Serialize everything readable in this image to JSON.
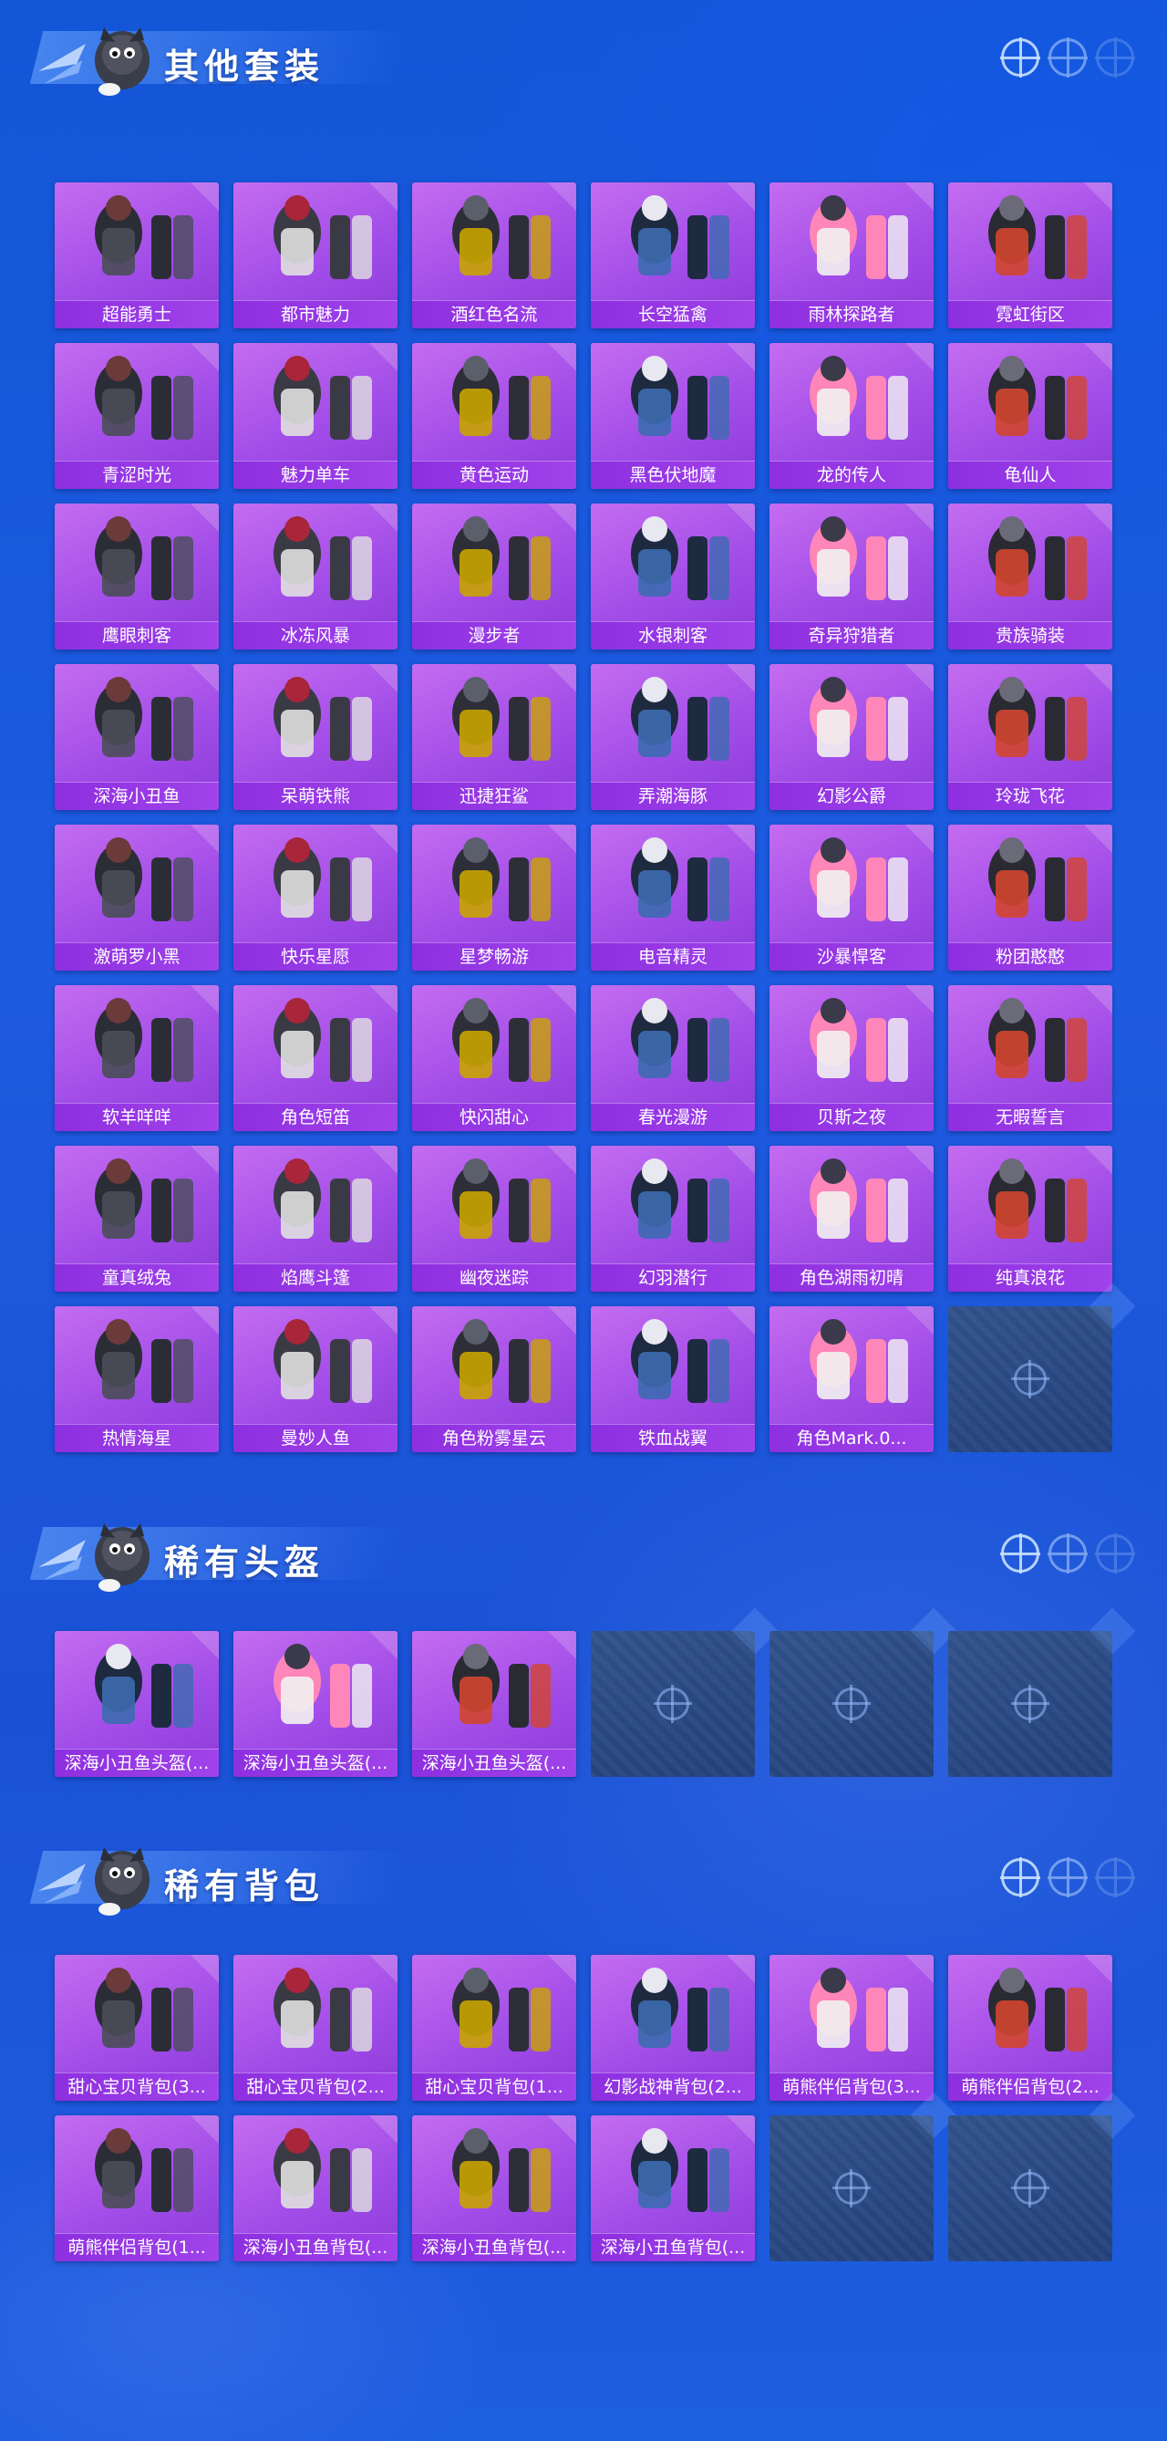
{
  "sections": [
    {
      "title": "其他套装",
      "items": [
        "超能勇士",
        "都市魅力",
        "酒红色名流",
        "长空猛禽",
        "雨林探路者",
        "霓虹街区",
        "青涩时光",
        "魅力单车",
        "黄色运动",
        "黑色伏地魔",
        "龙的传人",
        "龟仙人",
        "鹰眼刺客",
        "冰冻风暴",
        "漫步者",
        "水银刺客",
        "奇异狩猎者",
        "贵族骑装",
        "深海小丑鱼",
        "呆萌铁熊",
        "迅捷狂鲨",
        "弄潮海豚",
        "幻影公爵",
        "玲珑飞花",
        "激萌罗小黑",
        "快乐星愿",
        "星梦畅游",
        "电音精灵",
        "沙暴悍客",
        "粉团憨憨",
        "软羊咩咩",
        "角色短笛",
        "快闪甜心",
        "春光漫游",
        "贝斯之夜",
        "无暇誓言",
        "童真绒兔",
        "焰鹰斗篷",
        "幽夜迷踪",
        "幻羽潜行",
        "角色湖雨初晴",
        "纯真浪花",
        "热情海星",
        "曼妙人鱼",
        "角色粉雾星云",
        "铁血战翼",
        "角色Mark.0..."
      ],
      "empty_slots": 1
    },
    {
      "title": "稀有头盔",
      "items": [
        "深海小丑鱼头盔(...",
        "深海小丑鱼头盔(...",
        "深海小丑鱼头盔(..."
      ],
      "empty_slots": 3
    },
    {
      "title": "稀有背包",
      "items": [
        "甜心宝贝背包(3...",
        "甜心宝贝背包(2...",
        "甜心宝贝背包(1...",
        "幻影战神背包(2...",
        "萌熊伴侣背包(3...",
        "萌熊伴侣背包(2...",
        "萌熊伴侣背包(1...",
        "深海小丑鱼背包(...",
        "深海小丑鱼背包(...",
        "深海小丑鱼背包(..."
      ],
      "empty_slots": 2
    }
  ],
  "icons": {
    "header_deco": "crosshair-icon",
    "empty_slot": "crosshair-icon",
    "mascot": "mascot-icon"
  },
  "colors": {
    "card": "#a24de8",
    "label_bar": "#8e2fe0",
    "empty_slot": "#2a4880",
    "background": "#1a56dc"
  }
}
